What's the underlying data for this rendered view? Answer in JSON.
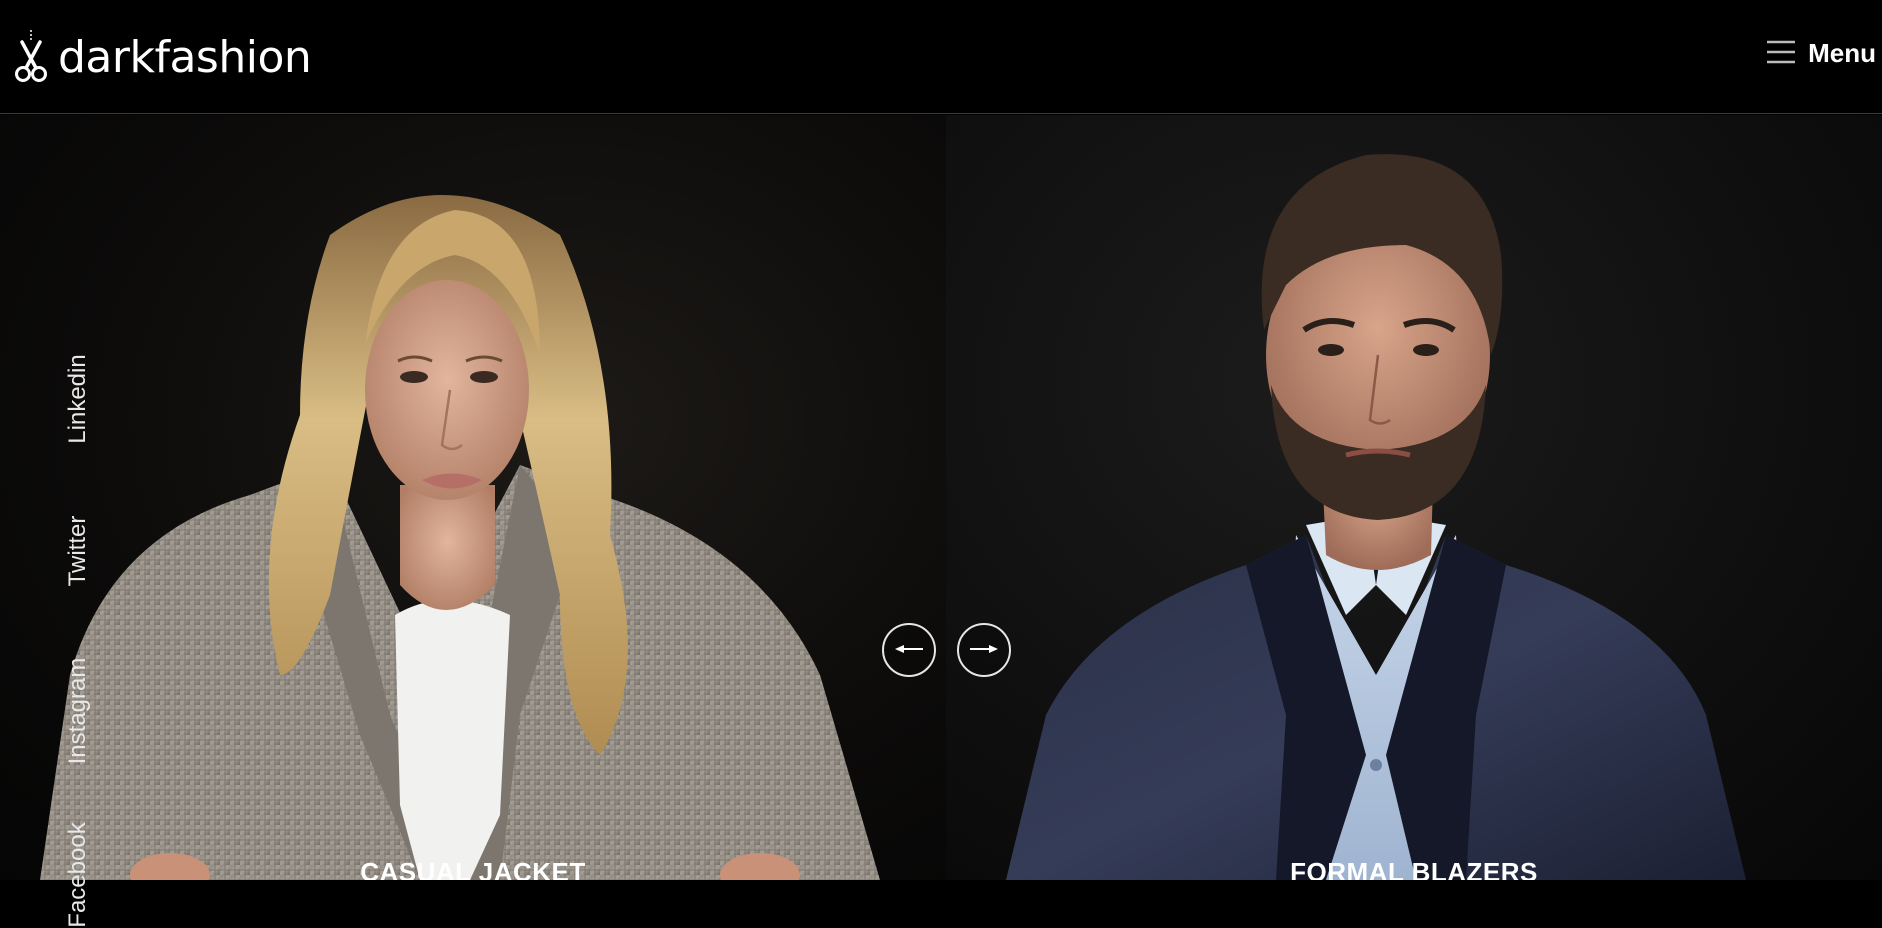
{
  "brand": {
    "name": "darkfashion"
  },
  "header": {
    "menu_label": "Menu"
  },
  "social": [
    "Linkedin",
    "Twitter",
    "Instagram",
    "Facebook"
  ],
  "slides": [
    {
      "caption": "CASUAL JACKET"
    },
    {
      "caption": "FORMAL BLAZERS"
    }
  ],
  "colors": {
    "background": "#000000",
    "text": "#ffffff",
    "divider": "#3a3a3a"
  },
  "icons": {
    "logo": "scissors-icon",
    "menu": "hamburger-icon",
    "prev": "arrow-left-icon",
    "next": "arrow-right-icon"
  }
}
